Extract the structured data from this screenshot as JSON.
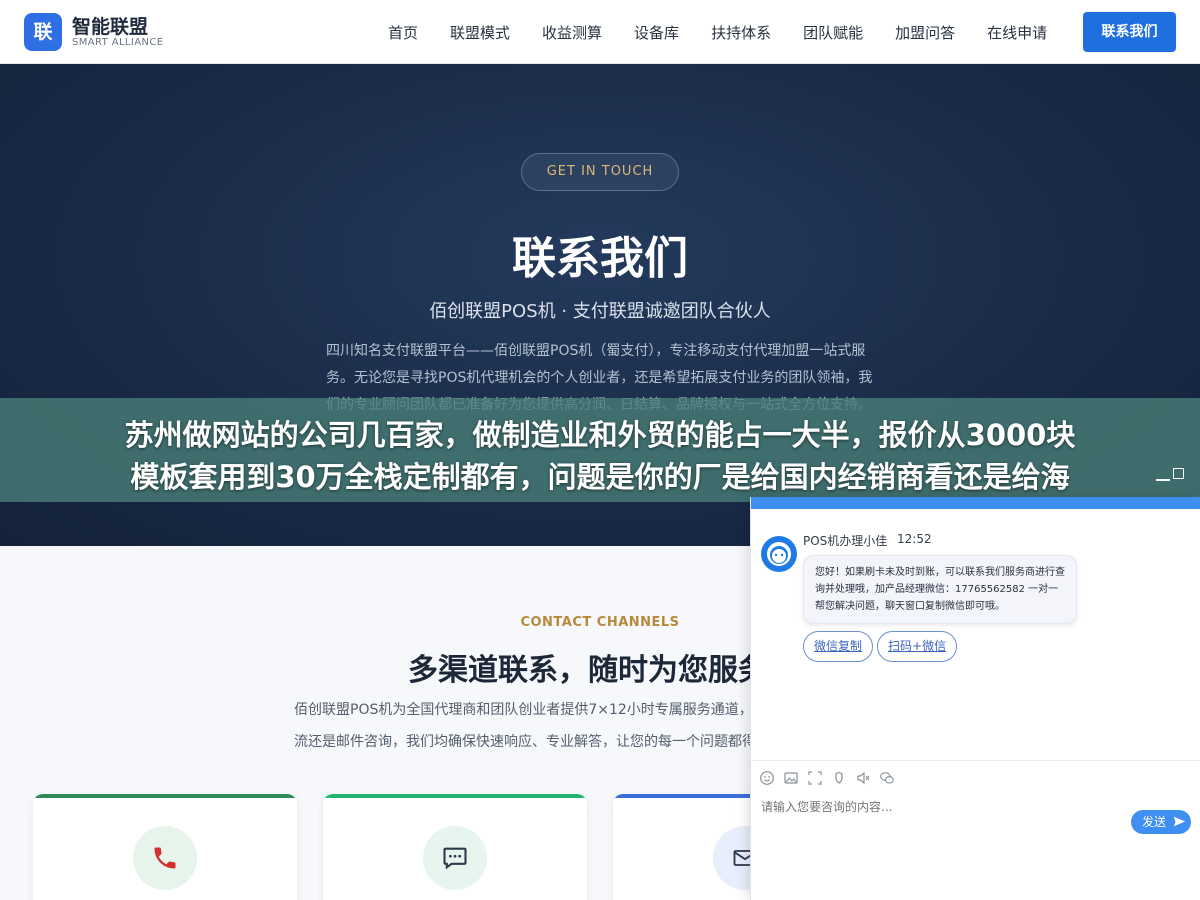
{
  "header": {
    "logo_mark": "联",
    "logo_title": "智能联盟",
    "logo_subtitle": "SMART ALLIANCE",
    "nav": [
      "首页",
      "联盟模式",
      "收益测算",
      "设备库",
      "扶持体系",
      "团队赋能",
      "加盟问答",
      "在线申请"
    ],
    "cta_label": "联系我们"
  },
  "hero": {
    "badge": "GET IN TOUCH",
    "title": "联系我们",
    "subtitle": "佰创联盟POS机 · 支付联盟诚邀团队合伙人",
    "description": "四川知名支付联盟平台——佰创联盟POS机（蜀支付），专注移动支付代理加盟一站式服务。无论您是寻找POS机代理机会的个人创业者，还是希望拓展支付业务的团队领袖，我们的专业顾问团队都已准备好为您提供高分润、日结算、品牌授权与一站式全方位支持。"
  },
  "overlay_banner": {
    "line1": "苏州做网站的公司几百家，做制造业和外贸的能占一大半，报价从3000块",
    "line2": "模板套用到30万全栈定制都有，问题是你的厂是给国内经销商看还是给海"
  },
  "channels": {
    "kicker": "CONTACT CHANNELS",
    "title": "多渠道联系，随时为您服务",
    "description": "佰创联盟POS机为全国代理商和团队创业者提供7×12小时专属服务通道，无论是电话沟通、微信交流还是邮件咨询，我们均确保快速响应、专业解答，让您的每一个问题都得到解决。",
    "cards": [
      {
        "icon": "phone-icon",
        "accent": "#2e8b57"
      },
      {
        "icon": "chat-bubble-icon",
        "accent": "#22b573"
      },
      {
        "icon": "mail-icon",
        "accent": "#3a6fd8"
      }
    ]
  },
  "chat": {
    "agent_name": "POS机办理小佳",
    "time": "12:52",
    "message": "您好！如果刷卡未及时到账，可以联系我们服务商进行查询并处理哦，加产品经理微信：17765562582 一对一帮您解决问题，聊天窗口复制微信即可哦。",
    "quick_replies": [
      "微信复制",
      "扫码+微信"
    ],
    "tools": [
      "emoji-icon",
      "image-icon",
      "screenshot-icon",
      "rate-icon",
      "voice-icon",
      "wechat-icon"
    ],
    "input_placeholder": "请输入您要咨询的内容...",
    "send_label": "发送",
    "accent": "#3f8ff0"
  }
}
